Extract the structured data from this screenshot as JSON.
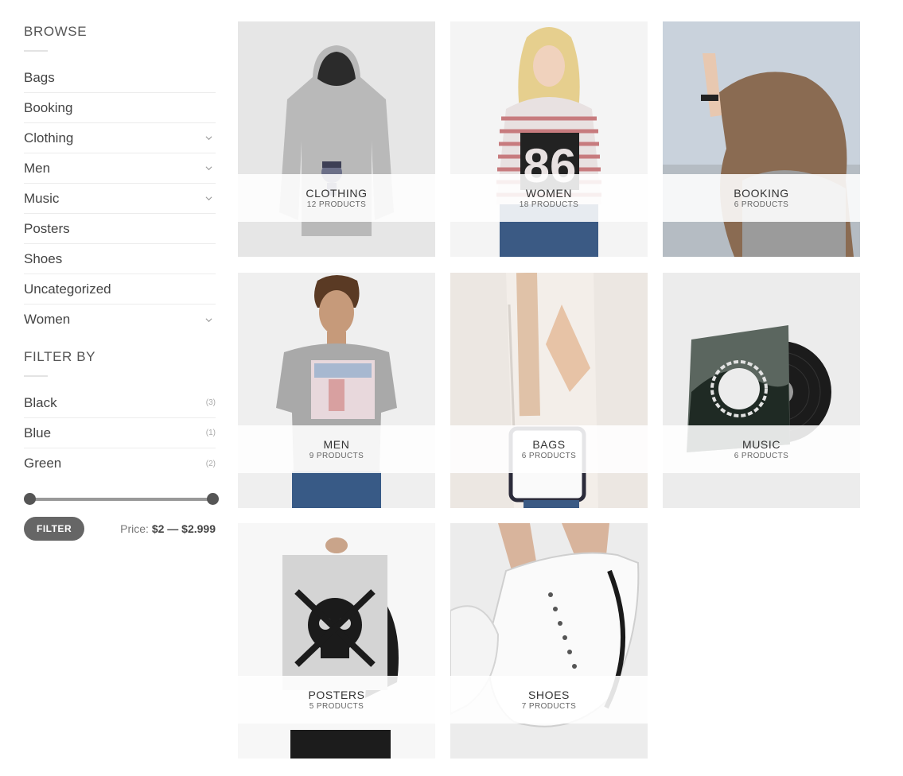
{
  "sidebar": {
    "browse_title": "BROWSE",
    "categories": [
      {
        "label": "Bags",
        "expandable": false
      },
      {
        "label": "Booking",
        "expandable": false
      },
      {
        "label": "Clothing",
        "expandable": true
      },
      {
        "label": "Men",
        "expandable": true
      },
      {
        "label": "Music",
        "expandable": true
      },
      {
        "label": "Posters",
        "expandable": false
      },
      {
        "label": "Shoes",
        "expandable": false
      },
      {
        "label": "Uncategorized",
        "expandable": false
      },
      {
        "label": "Women",
        "expandable": true
      }
    ],
    "filter_title": "FILTER BY",
    "filters": [
      {
        "label": "Black",
        "count": "(3)"
      },
      {
        "label": "Blue",
        "count": "(1)"
      },
      {
        "label": "Green",
        "count": "(2)"
      }
    ],
    "filter_button": "FILTER",
    "price_prefix": "Price:",
    "price_range": "$2 — $2.999",
    "slider": {
      "min_fraction": 0.0,
      "max_fraction": 1.0
    }
  },
  "grid": {
    "tiles": [
      {
        "name": "CLOTHING",
        "count": "12 PRODUCTS"
      },
      {
        "name": "WOMEN",
        "count": "18 PRODUCTS"
      },
      {
        "name": "BOOKING",
        "count": "6 PRODUCTS"
      },
      {
        "name": "MEN",
        "count": "9 PRODUCTS"
      },
      {
        "name": "BAGS",
        "count": "6 PRODUCTS"
      },
      {
        "name": "MUSIC",
        "count": "6 PRODUCTS"
      },
      {
        "name": "POSTERS",
        "count": "5 PRODUCTS"
      },
      {
        "name": "SHOES",
        "count": "7 PRODUCTS"
      }
    ]
  },
  "colors": {
    "button": "#666666",
    "divider": "#ececec",
    "text": "#444444"
  }
}
